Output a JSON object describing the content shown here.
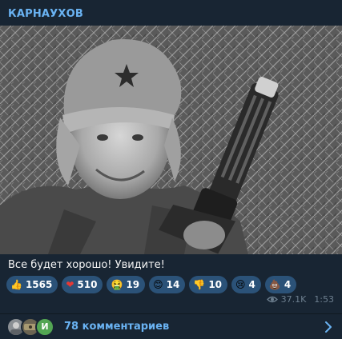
{
  "post": {
    "channel_name": "КАРНАУХОВ",
    "caption": "Все будет хорошо! Увидите!",
    "views": "37.1K",
    "time": "1:53"
  },
  "reactions": [
    {
      "icon": "thumbs-up-icon",
      "emoji": "👍",
      "count": "1565"
    },
    {
      "icon": "heart-icon",
      "emoji": "❤",
      "count": "510"
    },
    {
      "icon": "nauseated-face-icon",
      "emoji": "🤮",
      "count": "19"
    },
    {
      "icon": "smiling-face-icon",
      "emoji": "😊",
      "count": "14"
    },
    {
      "icon": "thumbs-down-icon",
      "emoji": "👎",
      "count": "10"
    },
    {
      "icon": "crying-face-icon",
      "emoji": "😢",
      "count": "4"
    },
    {
      "icon": "pile-of-poo-icon",
      "emoji": "💩",
      "count": "4"
    }
  ],
  "comments": {
    "label": "78 комментариев",
    "avatar_letter": "И"
  },
  "colors": {
    "background": "#182533",
    "accent": "#6ab3f3",
    "reaction_bg": "#2b5278",
    "meta": "#6d7f8f"
  }
}
